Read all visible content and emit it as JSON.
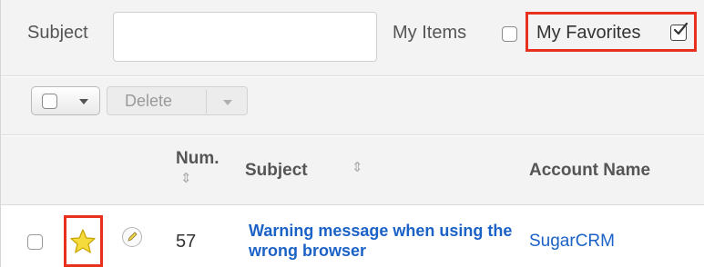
{
  "filter": {
    "subject_label": "Subject",
    "subject_value": "",
    "my_items_label": "My Items",
    "my_items_checked": false,
    "my_favorites_label": "My Favorites",
    "my_favorites_checked": true,
    "highlight_color": "#e7301e"
  },
  "actions": {
    "delete_label": "Delete"
  },
  "table": {
    "columns": {
      "num": "Num.",
      "subject": "Subject",
      "account": "Account Name"
    },
    "rows": [
      {
        "favorite": true,
        "num": "57",
        "subject": "Warning message when using the wrong browser",
        "account": "SugarCRM"
      }
    ]
  },
  "icons": [
    "checkbox-icon",
    "chevron-down-icon",
    "sort-icon",
    "star-icon",
    "pencil-icon"
  ],
  "colors": {
    "link": "#1b62c6",
    "star": "#f5dc3c"
  }
}
